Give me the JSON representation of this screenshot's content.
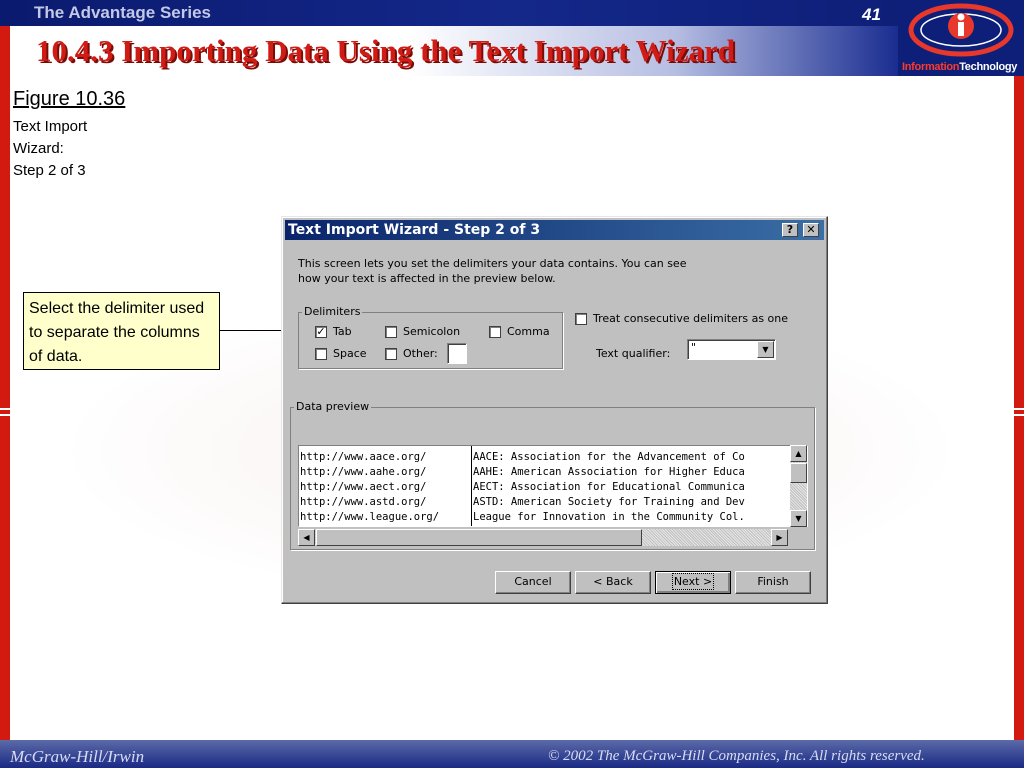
{
  "slide": {
    "series": "The Advantage Series",
    "page_number": "41",
    "title": "10.4.3 Importing Data Using the Text Import Wizard",
    "logo_red": "Information",
    "logo_white": "Technology",
    "publisher": "McGraw-Hill/Irwin",
    "copyright": "© 2002  The McGraw-Hill Companies, Inc. All rights reserved."
  },
  "caption": {
    "figure": "Figure 10.36",
    "line1": "Text Import",
    "line2": "Wizard:",
    "line3": "Step 2 of 3"
  },
  "callout": {
    "text": "Select the delimiter used to separate the columns of data."
  },
  "dialog": {
    "title": "Text Import Wizard - Step 2 of 3",
    "help_button": "?",
    "close_button": "✕",
    "intro_line1": "This screen lets you set the delimiters your data contains.  You can see",
    "intro_line2": "how your text is affected in the preview below.",
    "delimiters": {
      "group_label": "Delimiters",
      "tab": {
        "label": "Tab",
        "checked": true
      },
      "semicolon": {
        "label": "Semicolon",
        "checked": false
      },
      "comma": {
        "label": "Comma",
        "checked": false
      },
      "space": {
        "label": "Space",
        "checked": false
      },
      "other": {
        "label": "Other:",
        "checked": false
      }
    },
    "treat_consecutive": {
      "label": "Treat consecutive delimiters as one",
      "checked": false
    },
    "qualifier": {
      "label": "Text qualifier:",
      "value": "\""
    },
    "preview": {
      "group_label": "Data preview",
      "rows": [
        {
          "url": "http://www.aace.org/",
          "desc": "AACE: Association for the Advancement of Co"
        },
        {
          "url": "http://www.aahe.org/",
          "desc": "AAHE: American Association for Higher Educa"
        },
        {
          "url": "http://www.aect.org/",
          "desc": "AECT: Association for Educational Communica"
        },
        {
          "url": "http://www.astd.org/",
          "desc": "ASTD: American Society for Training and Dev"
        },
        {
          "url": "http://www.league.org/",
          "desc": "League for Innovation in the Community Col."
        }
      ]
    },
    "buttons": {
      "cancel": "Cancel",
      "back": "< Back",
      "next": "Next >",
      "finish": "Finish"
    }
  },
  "colors": {
    "accent_red": "#d21a10",
    "navy": "#0d1f78",
    "callout_fill": "#ffffcc",
    "dialog_face": "#c0c0c0"
  }
}
